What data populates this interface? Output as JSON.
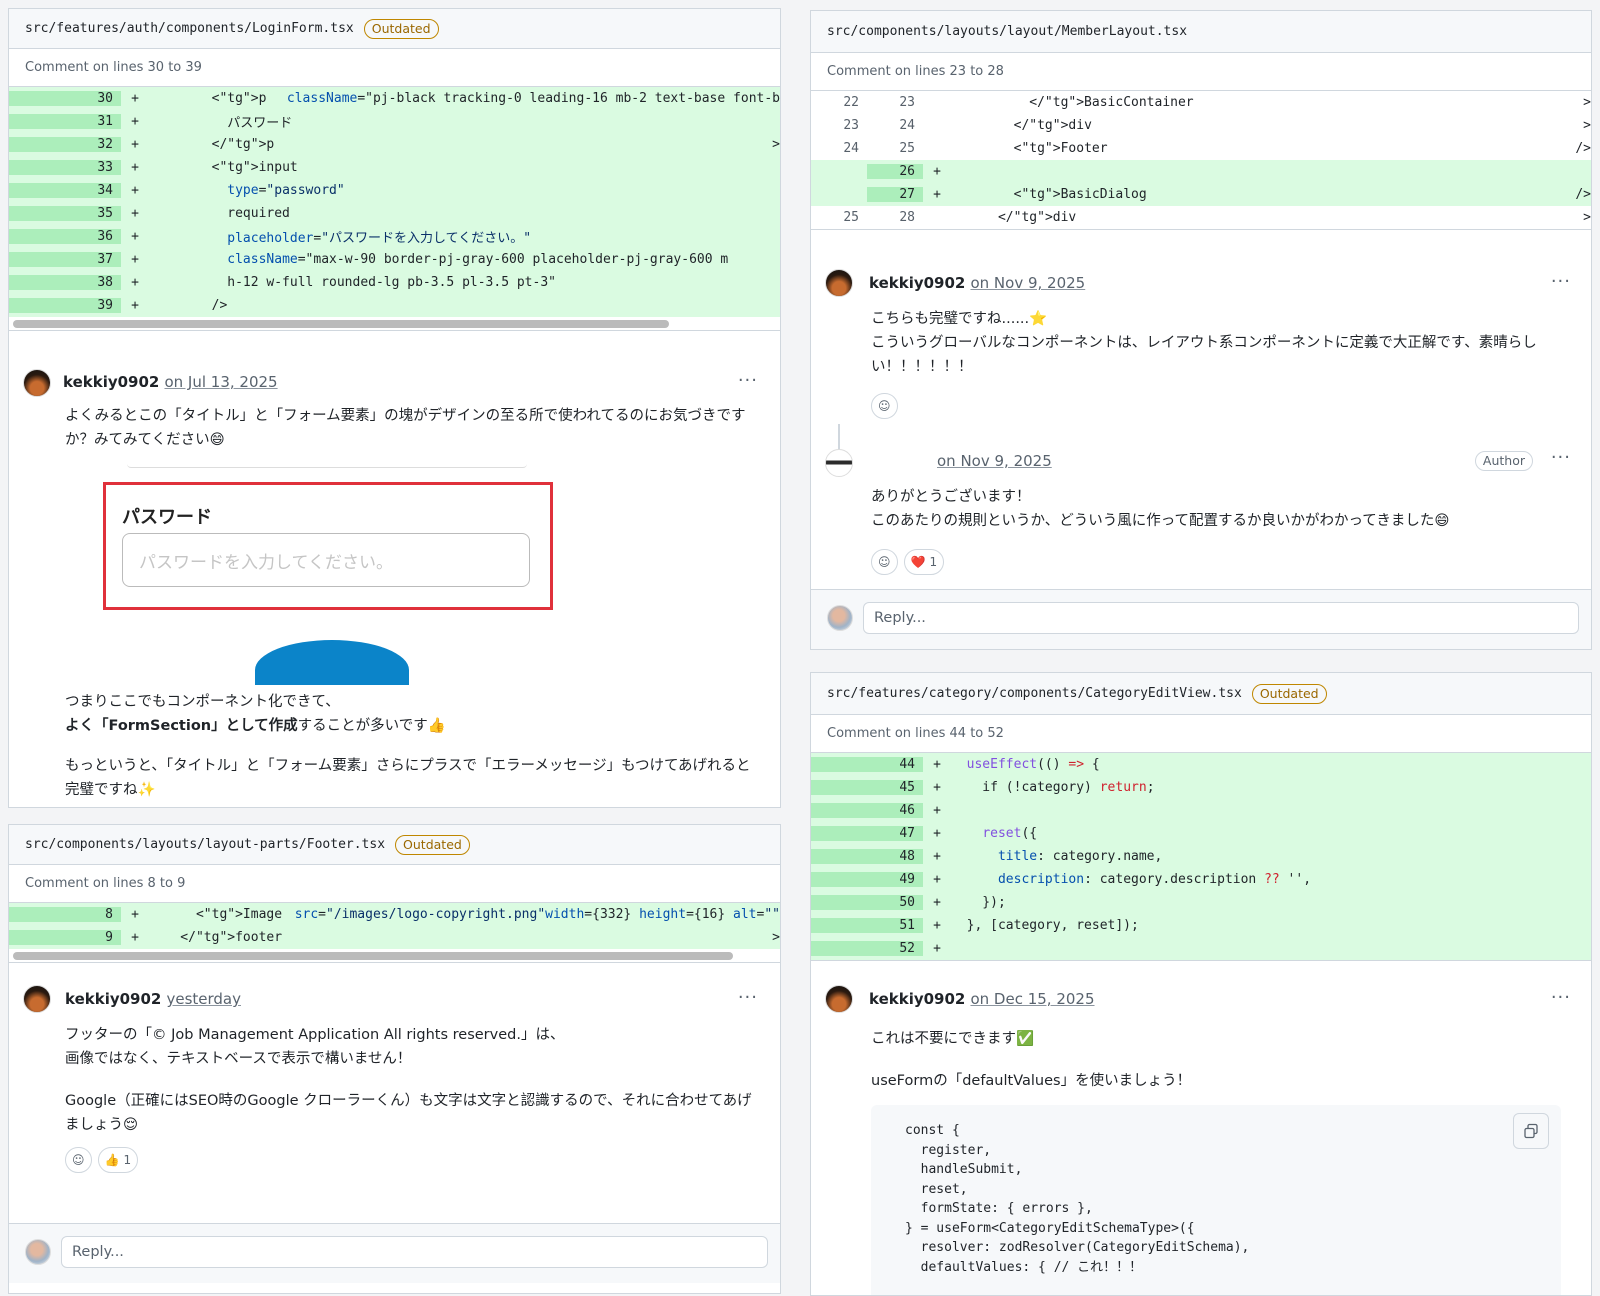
{
  "c1": {
    "path": "src/features/auth/components/LoginForm.tsx",
    "badge": "Outdated",
    "meta": "Comment on lines 30 to 39",
    "lines": [
      {
        "n": "30",
        "t": "        <p className=\"pj-black tracking-0 leading-16 mb-2 text-base font-b"
      },
      {
        "n": "31",
        "t": "          パスワード"
      },
      {
        "n": "32",
        "t": "        </p>"
      },
      {
        "n": "33",
        "t": "        <input"
      },
      {
        "n": "34",
        "t": "          type=\"password\""
      },
      {
        "n": "35",
        "t": "          required"
      },
      {
        "n": "36",
        "t": "          placeholder=\"パスワードを入力してください。\""
      },
      {
        "n": "37",
        "t": "          className=\"max-w-90 border-pj-gray-600 placeholder-pj-gray-600 m"
      },
      {
        "n": "38",
        "t": "          h-12 w-full rounded-lg pb-3.5 pl-3.5 pt-3\""
      },
      {
        "n": "39",
        "t": "        />"
      }
    ],
    "user": "kekkiy0902",
    "date": "on Jul 13, 2025",
    "p1": "よくみるとこの「タイトル」と「フォーム要素」の塊がデザインの至る所で使われてるのにお気づきですか？みてみてください😄",
    "img_label": "パスワード",
    "img_placeholder": "パスワードを入力してください。",
    "p2a": "つまりここでもコンポーネント化できて、",
    "p2b_bold": "よく「FormSection」として作成",
    "p2b_rest": "することが多いです👍",
    "p3": "もっというと、「タイトル」と「フォーム要素」さらにプラスで「エラーメッセージ」もつけてあげれると完璧ですね✨"
  },
  "c2": {
    "path": "src/components/layouts/layout-parts/Footer.tsx",
    "badge": "Outdated",
    "meta": "Comment on lines 8 to 9",
    "lines": [
      {
        "n": "8",
        "t": "      <Image src=\"/images/logo-copyright.png\" width={332} height={16} alt=\"\""
      },
      {
        "n": "9",
        "t": "    </footer>"
      }
    ],
    "user": "kekkiy0902",
    "date": "yesterday",
    "p1": "フッターの「© Job Management Application All rights reserved.」は、",
    "p2": "画像ではなく、テキストベースで表示で構いません！",
    "p3": "Google（正確にはSEO時のGoogle クローラーくん）も文字は文字と認識するので、それに合わせてあげましょう😌",
    "reaction_emoji": "👍",
    "reaction_count": "1",
    "reply": "Reply..."
  },
  "c3": {
    "path": "src/components/layouts/layout/MemberLayout.tsx",
    "meta": "Comment on lines 23 to 28",
    "lines": [
      {
        "a": "22",
        "b": "23",
        "s": " ",
        "t": "          </BasicContainer>",
        "k": "ctx"
      },
      {
        "a": "23",
        "b": "24",
        "s": " ",
        "t": "        </div>",
        "k": "ctx"
      },
      {
        "a": "24",
        "b": "25",
        "s": " ",
        "t": "        <Footer />",
        "k": "ctx"
      },
      {
        "a": "",
        "b": "26",
        "s": "+",
        "t": "",
        "k": "add"
      },
      {
        "a": "",
        "b": "27",
        "s": "+",
        "t": "        <BasicDialog />",
        "k": "add"
      },
      {
        "a": "25",
        "b": "28",
        "s": " ",
        "t": "      </div>",
        "k": "ctx"
      }
    ],
    "user": "kekkiy0902",
    "date": "on Nov 9, 2025",
    "p1": "こちらも完璧ですね......⭐",
    "p2": "こういうグローバルなコンポーネントは、レイアウト系コンポーネントに定義で大正解です、素晴らしい！！！！！！",
    "r_date": "on Nov 9, 2025",
    "r_badge": "Author",
    "r1": "ありがとうございます！",
    "r2": "このあたりの規則というか、どういう風に作って配置するか良いかがわかってきました😄",
    "heart": "❤️",
    "heart_count": "1",
    "reply": "Reply..."
  },
  "c4": {
    "path": "src/features/category/components/CategoryEditView.tsx",
    "badge": "Outdated",
    "meta": "Comment on lines 44 to 52",
    "lines": [
      {
        "n": "44",
        "t": "  useEffect(() => {"
      },
      {
        "n": "45",
        "t": "    if (!category) return;"
      },
      {
        "n": "46",
        "t": ""
      },
      {
        "n": "47",
        "t": "    reset({"
      },
      {
        "n": "48",
        "t": "      title: category.name,"
      },
      {
        "n": "49",
        "t": "      description: category.description ?? '',"
      },
      {
        "n": "50",
        "t": "    });"
      },
      {
        "n": "51",
        "t": "  }, [category, reset]);"
      },
      {
        "n": "52",
        "t": ""
      }
    ],
    "user": "kekkiy0902",
    "date": "on Dec 15, 2025",
    "p1": "これは不要にできます✅",
    "p2": "useFormの「defaultValues」を使いましょう！",
    "block": [
      "const {",
      "  register,",
      "  handleSubmit,",
      "  reset,",
      "  formState: { errors },",
      "} = useForm<CategoryEditSchemaType>({",
      "  resolver: zodResolver(CategoryEditSchema),",
      "  defaultValues: { // これ！！！"
    ]
  },
  "icons": [
    "smiley-icon",
    "copy-icon",
    "kebab-icon"
  ]
}
